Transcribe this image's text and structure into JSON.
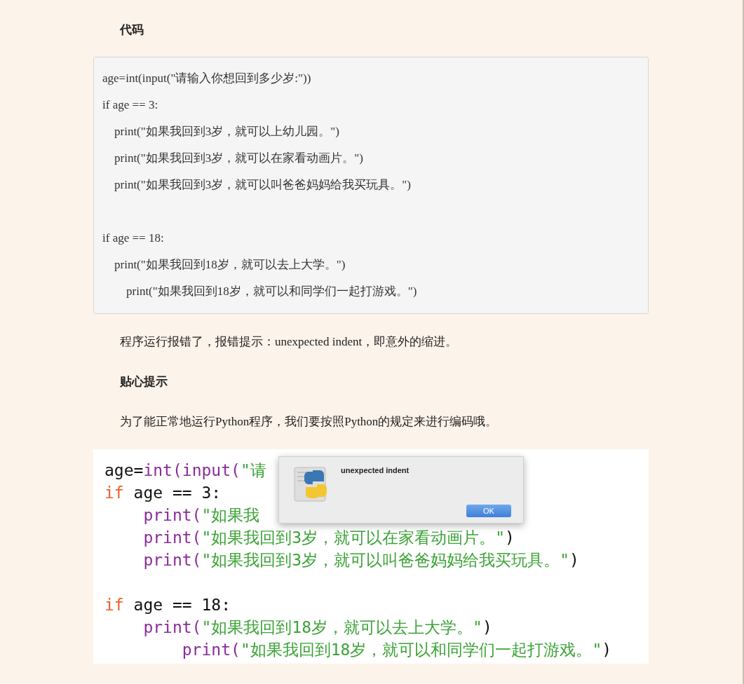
{
  "content": [
    {
      "kind": "heading",
      "text": "代码"
    },
    {
      "kind": "code",
      "blocks": [
        [
          "age=int(input(\"请输入你想回到多少岁:\"))",
          "if age == 3:",
          "    print(\"如果我回到3岁，就可以上幼儿园。\")",
          "    print(\"如果我回到3岁，就可以在家看动画片。\")",
          "    print(\"如果我回到3岁，就可以叫爸爸妈妈给我买玩具。\")"
        ],
        [
          "if age == 18:",
          "    print(\"如果我回到18岁，就可以去上大学。\")",
          "        print(\"如果我回到18岁，就可以和同学们一起打游戏。\")"
        ]
      ]
    },
    {
      "kind": "paragraph",
      "text": "程序运行报错了，报错提示：unexpected indent，即意外的缩进。"
    },
    {
      "kind": "heading",
      "text": "贴心提示"
    },
    {
      "kind": "paragraph",
      "text": "为了能正常地运行Python程序，我们要按照Python的规定来进行编码哦。"
    },
    {
      "kind": "screenshot",
      "blocks": [
        [
          [
            {
              "kind": "name",
              "text": "age="
            },
            {
              "kind": "builtin",
              "text": "int(input("
            },
            {
              "kind": "string",
              "text": "\"请"
            }
          ],
          [
            {
              "kind": "keyword",
              "text": "if"
            },
            {
              "kind": "name",
              "text": " age == 3:"
            }
          ],
          [
            {
              "kind": "builtin",
              "text": "    print("
            },
            {
              "kind": "string",
              "text": "\"如果我"
            }
          ],
          [
            {
              "kind": "builtin",
              "text": "    print("
            },
            {
              "kind": "string",
              "text": "\"如果我回到3岁，就可以在家看动画片。\""
            },
            {
              "kind": "name",
              "text": ")"
            }
          ],
          [
            {
              "kind": "builtin",
              "text": "    print("
            },
            {
              "kind": "string",
              "text": "\"如果我回到3岁，就可以叫爸爸妈妈给我买玩具。\""
            },
            {
              "kind": "name",
              "text": ")"
            }
          ]
        ],
        [
          [
            {
              "kind": "keyword",
              "text": "if"
            },
            {
              "kind": "name",
              "text": " age == 18:"
            }
          ],
          [
            {
              "kind": "builtin",
              "text": "    print("
            },
            {
              "kind": "string",
              "text": "\"如果我回到18岁，就可以去上大学。\""
            },
            {
              "kind": "name",
              "text": ")"
            }
          ],
          [
            {
              "kind": "builtin",
              "text": "        print("
            },
            {
              "kind": "string",
              "text": "\"如果我回到18岁，就可以和同学们一起打游戏。\""
            },
            {
              "kind": "name",
              "text": ")"
            }
          ]
        ]
      ],
      "dialog": {
        "message": "unexpected indent",
        "button": "OK"
      }
    }
  ]
}
